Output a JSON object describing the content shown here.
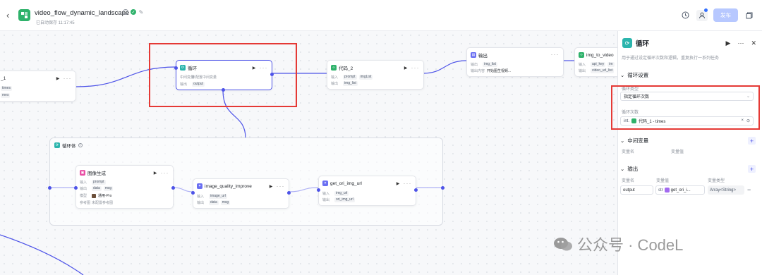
{
  "header": {
    "title": "video_flow_dynamic_landscape",
    "autosave": "已自动保存 11:17:45",
    "publish_label": "发布"
  },
  "canvas": {
    "code1_node": {
      "title": "_1",
      "rows": [
        "times",
        "mes"
      ]
    },
    "loop_node": {
      "title": "循环",
      "row1_key": "中间变量",
      "row1_val": "未配置中间变量",
      "row2_key": "输出",
      "row2_tag": "output"
    },
    "code2_node": {
      "title": "代码_2",
      "in_key": "输入",
      "in_tags": [
        "prompt",
        "imgList"
      ],
      "out_key": "输出",
      "out_tags": [
        "img_list"
      ]
    },
    "output_node": {
      "title": "输出",
      "in_key": "输出",
      "in_tag": "img_list",
      "content_key": "输出内容",
      "content_val": "开始图生视频..."
    },
    "img2video_node": {
      "title": "img_to_video",
      "in_key": "输入",
      "in_tags": [
        "api_key",
        "im"
      ],
      "out_key": "输出",
      "out_tags": [
        "video_url_list"
      ]
    },
    "loop_body": {
      "title": "循环体"
    },
    "image_gen_node": {
      "title": "图像生成",
      "in_key": "输入",
      "in_tag": "prompt",
      "out_key": "输出",
      "out_tags": [
        "data",
        "msg"
      ],
      "model_key": "模型",
      "model_val": "通用-Pro",
      "ref_key": "参考图",
      "ref_val": "未配置参考图"
    },
    "quality_node": {
      "title": "image_quality_improve",
      "in_key": "输入",
      "in_tag": "image_url",
      "out_key": "输出",
      "out_tags": [
        "data",
        "msg"
      ]
    },
    "get_img_node": {
      "title": "get_ori_img_url",
      "in_key": "输入",
      "in_tag": "img_url",
      "out_key": "输出",
      "out_tag": "ori_img_url"
    }
  },
  "panel": {
    "title": "循环",
    "description": "用于通过设定循环次数和逻辑，重复执行一系列任务",
    "loop_settings": {
      "section_title": "循环设置",
      "type_label": "循环类型",
      "type_value": "指定循环次数",
      "count_label": "循环次数",
      "count_type": "int.",
      "count_ref": "代码_1 - times"
    },
    "intermediate": {
      "section_title": "中间变量",
      "col_name": "变量名",
      "col_value": "变量值"
    },
    "output": {
      "section_title": "输出",
      "col_name": "变量名",
      "col_value": "变量值",
      "col_type": "变量类型",
      "row_name": "output",
      "row_prefix": "str",
      "row_ref": "get_ori_i...",
      "row_type": "Array<String>"
    }
  },
  "watermark": "公众号 · CodeL",
  "colors": {
    "accent": "#4d53e8",
    "loop_teal": "#2cb5ad",
    "code_green": "#2fb26b",
    "highlight_red": "#e53935"
  }
}
